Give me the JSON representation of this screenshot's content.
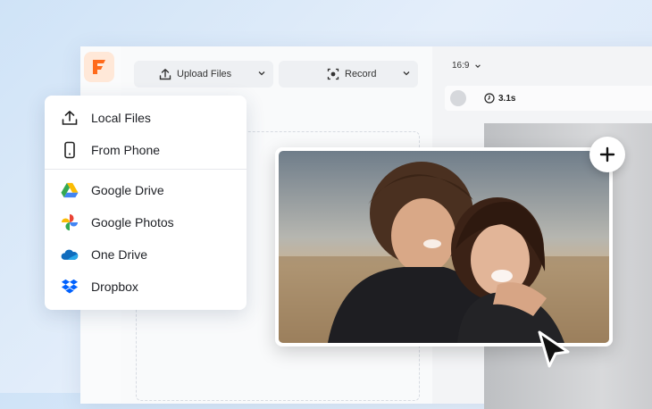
{
  "toolbar": {
    "upload_label": "Upload Files",
    "record_label": "Record"
  },
  "preview": {
    "aspect_ratio": "16:9",
    "duration": "3.1s"
  },
  "upload_menu": {
    "items": [
      {
        "label": "Local Files",
        "icon": "upload-icon"
      },
      {
        "label": "From Phone",
        "icon": "phone-icon"
      },
      {
        "label": "Google Drive",
        "icon": "google-drive-icon"
      },
      {
        "label": "Google Photos",
        "icon": "google-photos-icon"
      },
      {
        "label": "One Drive",
        "icon": "onedrive-icon"
      },
      {
        "label": "Dropbox",
        "icon": "dropbox-icon"
      }
    ]
  },
  "colors": {
    "brand": "#ff6a1a",
    "google_blue": "#4285f4",
    "google_green": "#34a853",
    "google_yellow": "#fbbc04",
    "google_red": "#ea4335",
    "onedrive": "#0f6cbd",
    "dropbox": "#0061fe"
  }
}
